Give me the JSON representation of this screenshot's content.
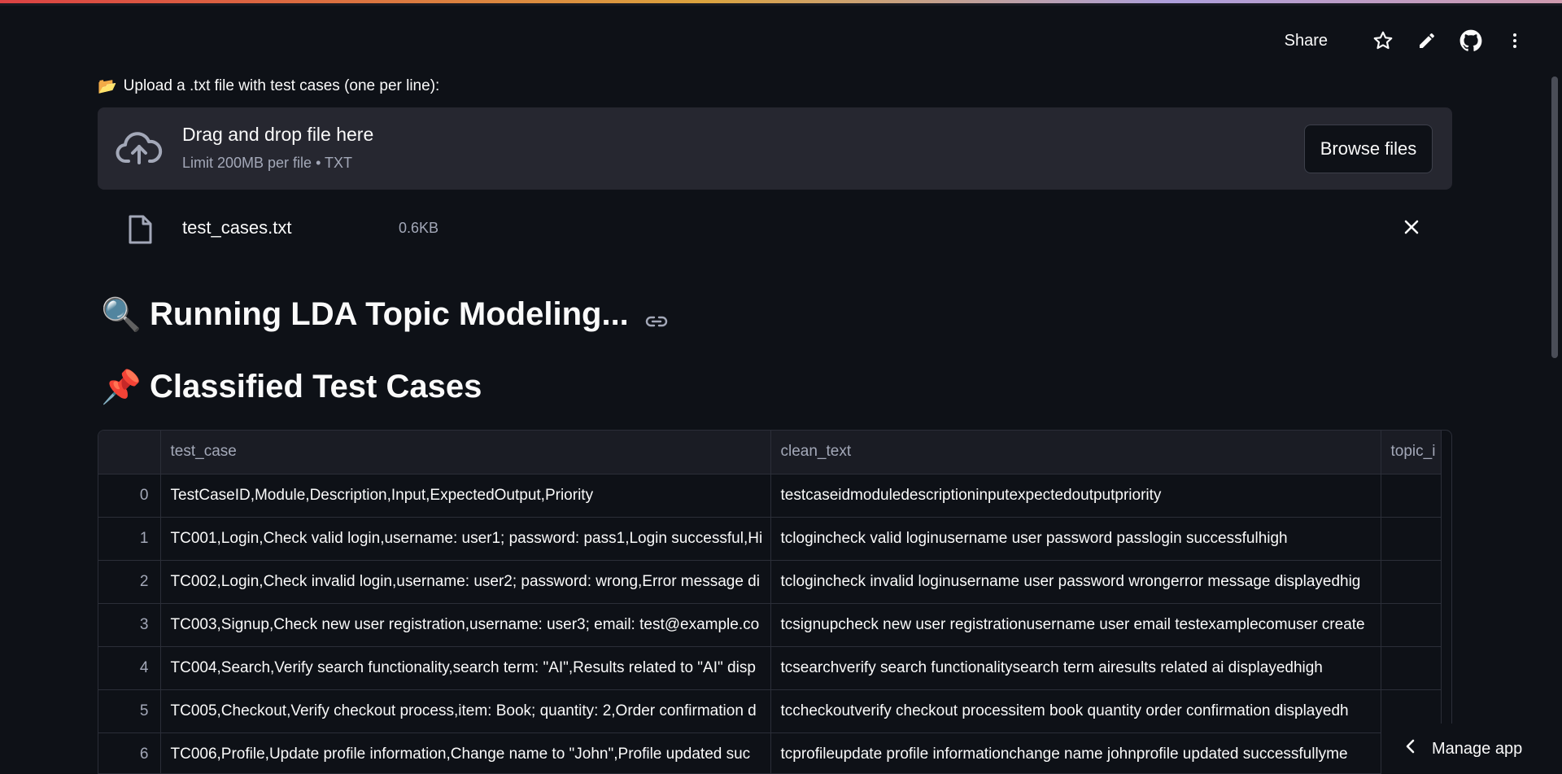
{
  "header": {
    "share_label": "Share",
    "icons": [
      "star-icon",
      "pencil-icon",
      "github-icon",
      "more-vertical-icon"
    ]
  },
  "uploader": {
    "label_icon": "📂",
    "label": "Upload a .txt file with test cases (one per line):",
    "drop_title": "Drag and drop file here",
    "drop_limit": "Limit 200MB per file • TXT",
    "browse_label": "Browse files",
    "file_name": "test_cases.txt",
    "file_size": "0.6KB"
  },
  "headings": {
    "running_emoji": "🔍",
    "running": "Running LDA Topic Modeling...",
    "classified_emoji": "📌",
    "classified": "Classified Test Cases"
  },
  "table": {
    "columns": [
      "",
      "test_case",
      "clean_text",
      "topic_i"
    ],
    "rows": [
      {
        "idx": "0",
        "test_case": "TestCaseID,Module,Description,Input,ExpectedOutput,Priority",
        "clean_text": "testcaseidmoduledescriptioninputexpectedoutputpriority",
        "topic": ""
      },
      {
        "idx": "1",
        "test_case": "TC001,Login,Check valid login,username: user1; password: pass1,Login successful,Hi",
        "clean_text": "tclogincheck valid loginusername user password passlogin successfulhigh",
        "topic": ""
      },
      {
        "idx": "2",
        "test_case": "TC002,Login,Check invalid login,username: user2; password: wrong,Error message di",
        "clean_text": "tclogincheck invalid loginusername user password wrongerror message displayedhig",
        "topic": ""
      },
      {
        "idx": "3",
        "test_case": "TC003,Signup,Check new user registration,username: user3; email: test@example.co",
        "clean_text": "tcsignupcheck new user registrationusername user email testexamplecomuser create",
        "topic": ""
      },
      {
        "idx": "4",
        "test_case": "TC004,Search,Verify search functionality,search term: \"AI\",Results related to \"AI\" disp",
        "clean_text": "tcsearchverify search functionalitysearch term airesults related ai displayedhigh",
        "topic": ""
      },
      {
        "idx": "5",
        "test_case": "TC005,Checkout,Verify checkout process,item: Book; quantity: 2,Order confirmation d",
        "clean_text": "tccheckoutverify checkout processitem book quantity order confirmation displayedh",
        "topic": ""
      },
      {
        "idx": "6",
        "test_case": "TC006,Profile,Update profile information,Change name to \"John\",Profile updated suc",
        "clean_text": "tcprofileupdate profile informationchange name johnprofile updated successfullyme",
        "topic": ""
      }
    ]
  },
  "footer": {
    "manage_app": "Manage app"
  }
}
